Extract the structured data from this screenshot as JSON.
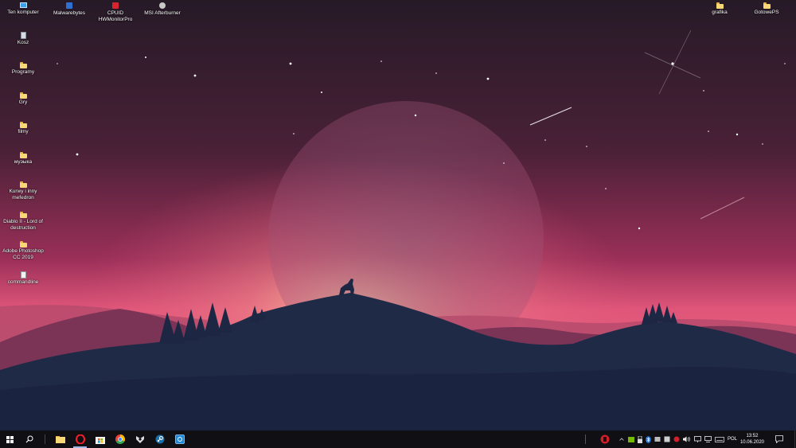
{
  "desktop": {
    "icons_left": [
      {
        "label": "Ten komputer",
        "icon": "computer-icon"
      },
      {
        "label": "Kosz",
        "icon": "recycle-bin-icon"
      },
      {
        "label": "Programy",
        "icon": "folder-icon"
      },
      {
        "label": "Gry",
        "icon": "folder-icon"
      },
      {
        "label": "filmy",
        "icon": "folder-icon"
      },
      {
        "label": "муэыка",
        "icon": "folder-icon"
      },
      {
        "label": "Kurwy i inny mefedron",
        "icon": "folder-icon"
      },
      {
        "label": "Diablo II - Lord of destruction",
        "icon": "folder-icon"
      },
      {
        "label": "Adobe Photoshop CC 2019",
        "icon": "folder-icon"
      },
      {
        "label": "commandline",
        "icon": "text-file-icon"
      }
    ],
    "icons_top": [
      {
        "label": "Malwarebytes",
        "icon": "malwarebytes-icon"
      },
      {
        "label": "CPUID HWMonitorPro",
        "icon": "hwmonitor-icon"
      },
      {
        "label": "MSI Afterburner",
        "icon": "afterburner-icon"
      }
    ],
    "icons_right": [
      {
        "label": "grafika",
        "icon": "folder-icon"
      },
      {
        "label": "GotowePS",
        "icon": "folder-icon"
      }
    ]
  },
  "taskbar": {
    "pinned": [
      "start-icon",
      "search-icon",
      "file-explorer-icon",
      "opera-icon",
      "store-icon",
      "chrome-icon",
      "kodi-icon",
      "steam-icon",
      "control-panel-icon"
    ],
    "language": "POL",
    "time": "13:52",
    "date": "10.06.2020"
  },
  "colors": {
    "sky_top": "#2a1b2a",
    "sky_mid": "#7d2c4e",
    "horizon": "#e55478",
    "glow": "#f9c9a0",
    "hills": "#1d2742",
    "taskbar": "#101014"
  }
}
